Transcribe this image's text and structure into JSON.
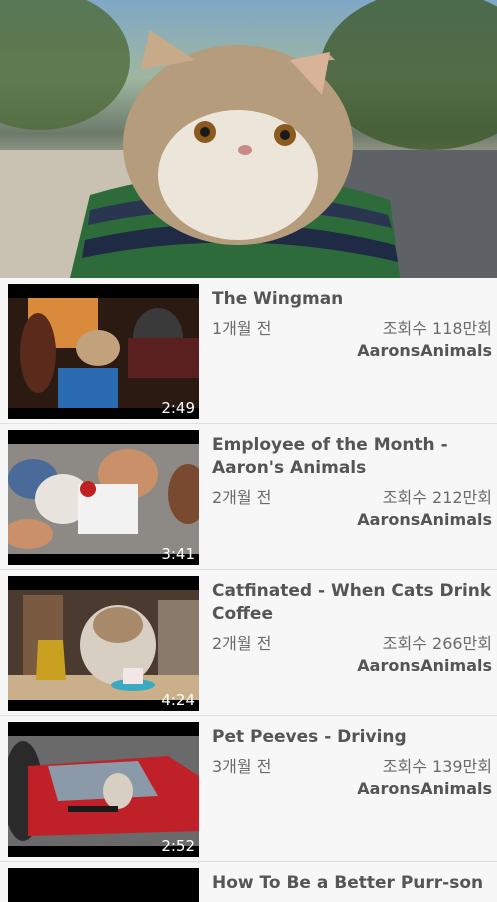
{
  "hero": {
    "icon": "cat-video-hero"
  },
  "videos": [
    {
      "title": "The Wingman",
      "age": "1개월 전",
      "views": "조회수 118만회",
      "channel": "AaronsAnimals",
      "duration": "2:49"
    },
    {
      "title": "Employee of the Month - Aaron's Animals",
      "age": "2개월 전",
      "views": "조회수 212만회",
      "channel": "AaronsAnimals",
      "duration": "3:41"
    },
    {
      "title": "Catfinated - When Cats Drink Coffee",
      "age": "2개월 전",
      "views": "조회수 266만회",
      "channel": "AaronsAnimals",
      "duration": "4:24"
    },
    {
      "title": "Pet Peeves - Driving",
      "age": "3개월 전",
      "views": "조회수 139만회",
      "channel": "AaronsAnimals",
      "duration": "2:52"
    },
    {
      "title": "How To Be a Better Purr-son"
    }
  ]
}
